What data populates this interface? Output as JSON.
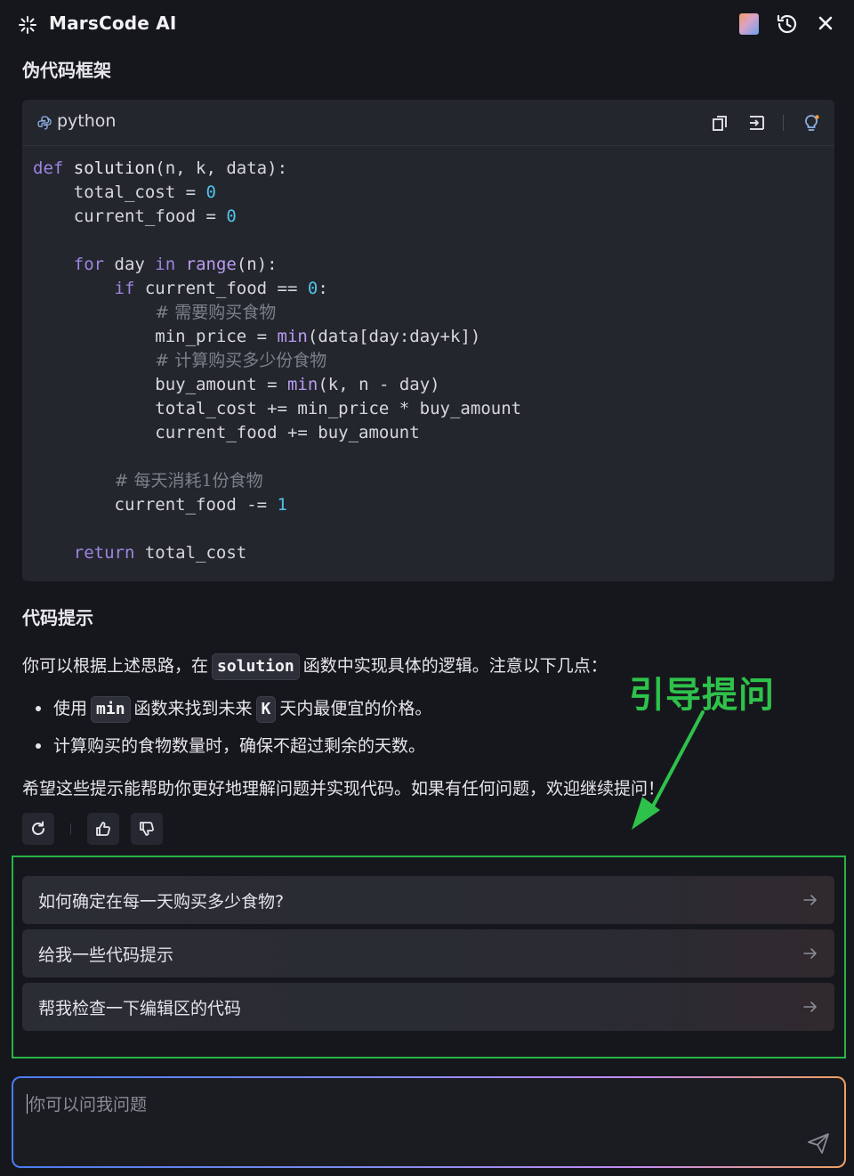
{
  "header": {
    "app_title": "MarsCode AI",
    "icons": [
      "sparkle-icon",
      "avatar",
      "history-icon",
      "close-icon"
    ]
  },
  "section_pseudocode_title": "伪代码框架",
  "code_block": {
    "language": "python",
    "lines": [
      [
        [
          "kw",
          "def"
        ],
        [
          "p",
          " "
        ],
        [
          "fn",
          "solution"
        ],
        [
          "p",
          "(n, k, data):"
        ]
      ],
      [
        [
          "p",
          "    total_cost = "
        ],
        [
          "num",
          "0"
        ]
      ],
      [
        [
          "p",
          "    current_food = "
        ],
        [
          "num",
          "0"
        ]
      ],
      [
        [
          "p",
          ""
        ]
      ],
      [
        [
          "p",
          "    "
        ],
        [
          "kw",
          "for"
        ],
        [
          "p",
          " day "
        ],
        [
          "kw",
          "in"
        ],
        [
          "p",
          " "
        ],
        [
          "bi",
          "range"
        ],
        [
          "p",
          "(n):"
        ]
      ],
      [
        [
          "p",
          "        "
        ],
        [
          "kw",
          "if"
        ],
        [
          "p",
          " current_food == "
        ],
        [
          "num",
          "0"
        ],
        [
          "p",
          ":"
        ]
      ],
      [
        [
          "p",
          "            "
        ],
        [
          "cm",
          "# 需要购买食物"
        ]
      ],
      [
        [
          "p",
          "            min_price = "
        ],
        [
          "bi",
          "min"
        ],
        [
          "p",
          "(data[day:day+k])"
        ]
      ],
      [
        [
          "p",
          "            "
        ],
        [
          "cm",
          "# 计算购买多少份食物"
        ]
      ],
      [
        [
          "p",
          "            buy_amount = "
        ],
        [
          "bi",
          "min"
        ],
        [
          "p",
          "(k, n - day)"
        ]
      ],
      [
        [
          "p",
          "            total_cost += min_price * buy_amount"
        ]
      ],
      [
        [
          "p",
          "            current_food += buy_amount"
        ]
      ],
      [
        [
          "p",
          ""
        ]
      ],
      [
        [
          "p",
          "        "
        ],
        [
          "cm",
          "# 每天消耗1份食物"
        ]
      ],
      [
        [
          "p",
          "        current_food -= "
        ],
        [
          "num",
          "1"
        ]
      ],
      [
        [
          "p",
          ""
        ]
      ],
      [
        [
          "p",
          "    "
        ],
        [
          "kw",
          "return"
        ],
        [
          "p",
          " total_cost"
        ]
      ]
    ],
    "toolbar_icons": [
      "copy-icon",
      "insert-icon",
      "lightbulb-icon"
    ]
  },
  "section_hint_title": "代码提示",
  "hint_intro": {
    "before": "你可以根据上述思路，在",
    "code": "solution",
    "after": "函数中实现具体的逻辑。注意以下几点："
  },
  "bullets": [
    {
      "before": "使用",
      "code": "min",
      "middle": "函数来找到未来",
      "code2": "K",
      "after": "天内最便宜的价格。"
    },
    {
      "text": "计算购买的食物数量时，确保不超过剩余的天数。"
    }
  ],
  "closing_text": "希望这些提示能帮助你更好地理解问题并实现代码。如果有任何问题，欢迎继续提问！",
  "annotation_label": "引导提问",
  "actions": [
    "regenerate-icon",
    "thumbs-up-icon",
    "thumbs-down-icon"
  ],
  "suggestions": [
    "如何确定在每一天购买多少食物?",
    "给我一些代码提示",
    "帮我检查一下编辑区的代码"
  ],
  "input": {
    "placeholder": "你可以问我问题"
  },
  "colors": {
    "background": "#16171d",
    "code_bg": "#24262e",
    "keyword": "#9d85e0",
    "number": "#4fc3ea",
    "annotation": "#2ec24a"
  }
}
